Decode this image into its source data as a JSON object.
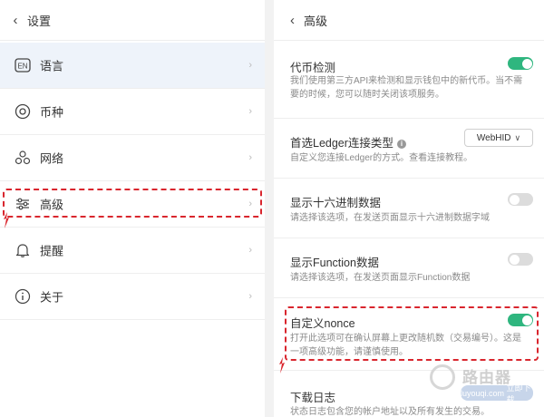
{
  "left": {
    "title": "设置",
    "items": [
      {
        "label": "语言",
        "icon": "en-language-icon"
      },
      {
        "label": "币种",
        "icon": "currency-icon"
      },
      {
        "label": "网络",
        "icon": "network-icon"
      },
      {
        "label": "高级",
        "icon": "sliders-icon"
      },
      {
        "label": "提醒",
        "icon": "bell-icon"
      },
      {
        "label": "关于",
        "icon": "info-icon"
      }
    ],
    "icon_text_en": "EN"
  },
  "right": {
    "title": "高级",
    "settings": [
      {
        "title": "代币检测",
        "desc": "我们使用第三方API来检测和显示钱包中的新代币。当不需要的时候，您可以随时关闭该项服务。",
        "state": "on"
      },
      {
        "title": "首选Ledger连接类型",
        "desc": "自定义您连接Ledger的方式。查看连接教程。",
        "select_value": "WebHID"
      },
      {
        "title": "显示十六进制数据",
        "desc": "请选择该选项，在发送页面显示十六进制数据字域",
        "state": "off"
      },
      {
        "title": "显示Function数据",
        "desc": "请选择该选项，在发送页面显示Function数据",
        "state": "off"
      },
      {
        "title": "自定义nonce",
        "desc": "打开此选项可在确认屏幕上更改随机数（交易编号）。这是一项高级功能，请谨慎使用。",
        "state": "on"
      },
      {
        "title": "下载日志",
        "desc": "状态日志包含您的帐户地址以及所有发生的交易。"
      }
    ]
  },
  "watermark": {
    "text": "路由器",
    "sub": "luyouqi.com",
    "button": "立即下载"
  },
  "colors": {
    "toggle_on": "#2fb67f",
    "toggle_off": "#dcdcdc",
    "highlight": "#d9262e",
    "selected_bg": "#eef3fa"
  }
}
